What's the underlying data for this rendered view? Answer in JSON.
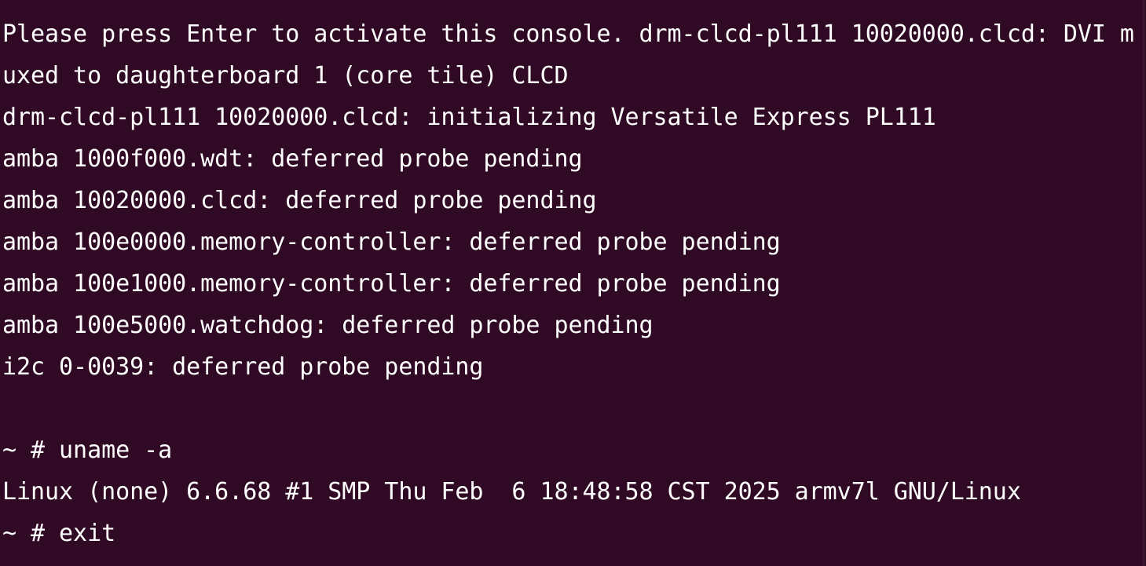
{
  "terminal": {
    "lines": [
      "Please press Enter to activate this console. drm-clcd-pl111 10020000.clcd: DVI m",
      "uxed to daughterboard 1 (core tile) CLCD",
      "drm-clcd-pl111 10020000.clcd: initializing Versatile Express PL111",
      "amba 1000f000.wdt: deferred probe pending",
      "amba 10020000.clcd: deferred probe pending",
      "amba 100e0000.memory-controller: deferred probe pending",
      "amba 100e1000.memory-controller: deferred probe pending",
      "amba 100e5000.watchdog: deferred probe pending",
      "i2c 0-0039: deferred probe pending",
      "",
      "~ # uname -a",
      "Linux (none) 6.6.68 #1 SMP Thu Feb  6 18:48:58 CST 2025 armv7l GNU/Linux",
      "~ # exit"
    ]
  },
  "colors": {
    "background": "#300a24",
    "foreground": "#ffffff"
  }
}
